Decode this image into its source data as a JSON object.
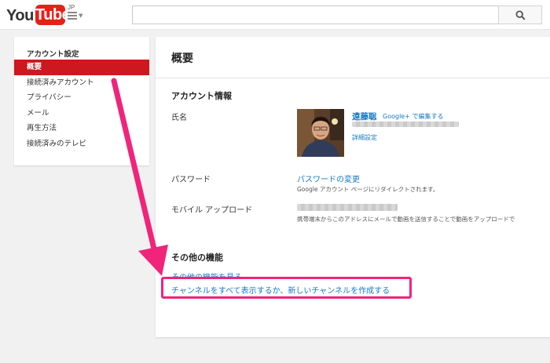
{
  "header": {
    "logo_you": "You",
    "logo_tube": "Tube",
    "logo_region": "JP",
    "search_value": "",
    "search_placeholder": "",
    "icons": [
      "guide-menu-icon",
      "search-icon"
    ]
  },
  "sidebar": {
    "title": "アカウント設定",
    "items": [
      {
        "label": "概要",
        "active": true
      },
      {
        "label": "接続済みアカウント",
        "active": false
      },
      {
        "label": "プライバシー",
        "active": false
      },
      {
        "label": "メール",
        "active": false
      },
      {
        "label": "再生方法",
        "active": false
      },
      {
        "label": "接続済みのテレビ",
        "active": false
      }
    ]
  },
  "main": {
    "title": "概要",
    "account_info": {
      "heading": "アカウント情報",
      "name_label": "氏名",
      "name_value": "遠藤聡",
      "google_plus_edit": "Google+ で編集する",
      "advanced_link": "詳細設定",
      "password_label": "パスワード",
      "password_link": "パスワードの変更",
      "password_hint": "Google アカウント ページにリダイレクトされます。",
      "mobile_label": "モバイル アップロード",
      "mobile_hint": "携帯端末からこのアドレスにメールで動画を送信することで動画をアップロードで"
    },
    "other": {
      "heading": "その他の機能",
      "more_link": "その他の機能を見る",
      "channel_link": "チャンネルをすべて表示するか、新しいチャンネルを作成する"
    }
  },
  "colors": {
    "youtube_red": "#e62117",
    "active_item": "#cc181e",
    "link": "#167ac6",
    "annotation": "#f0247a",
    "page_bg": "#f1f1f1"
  }
}
